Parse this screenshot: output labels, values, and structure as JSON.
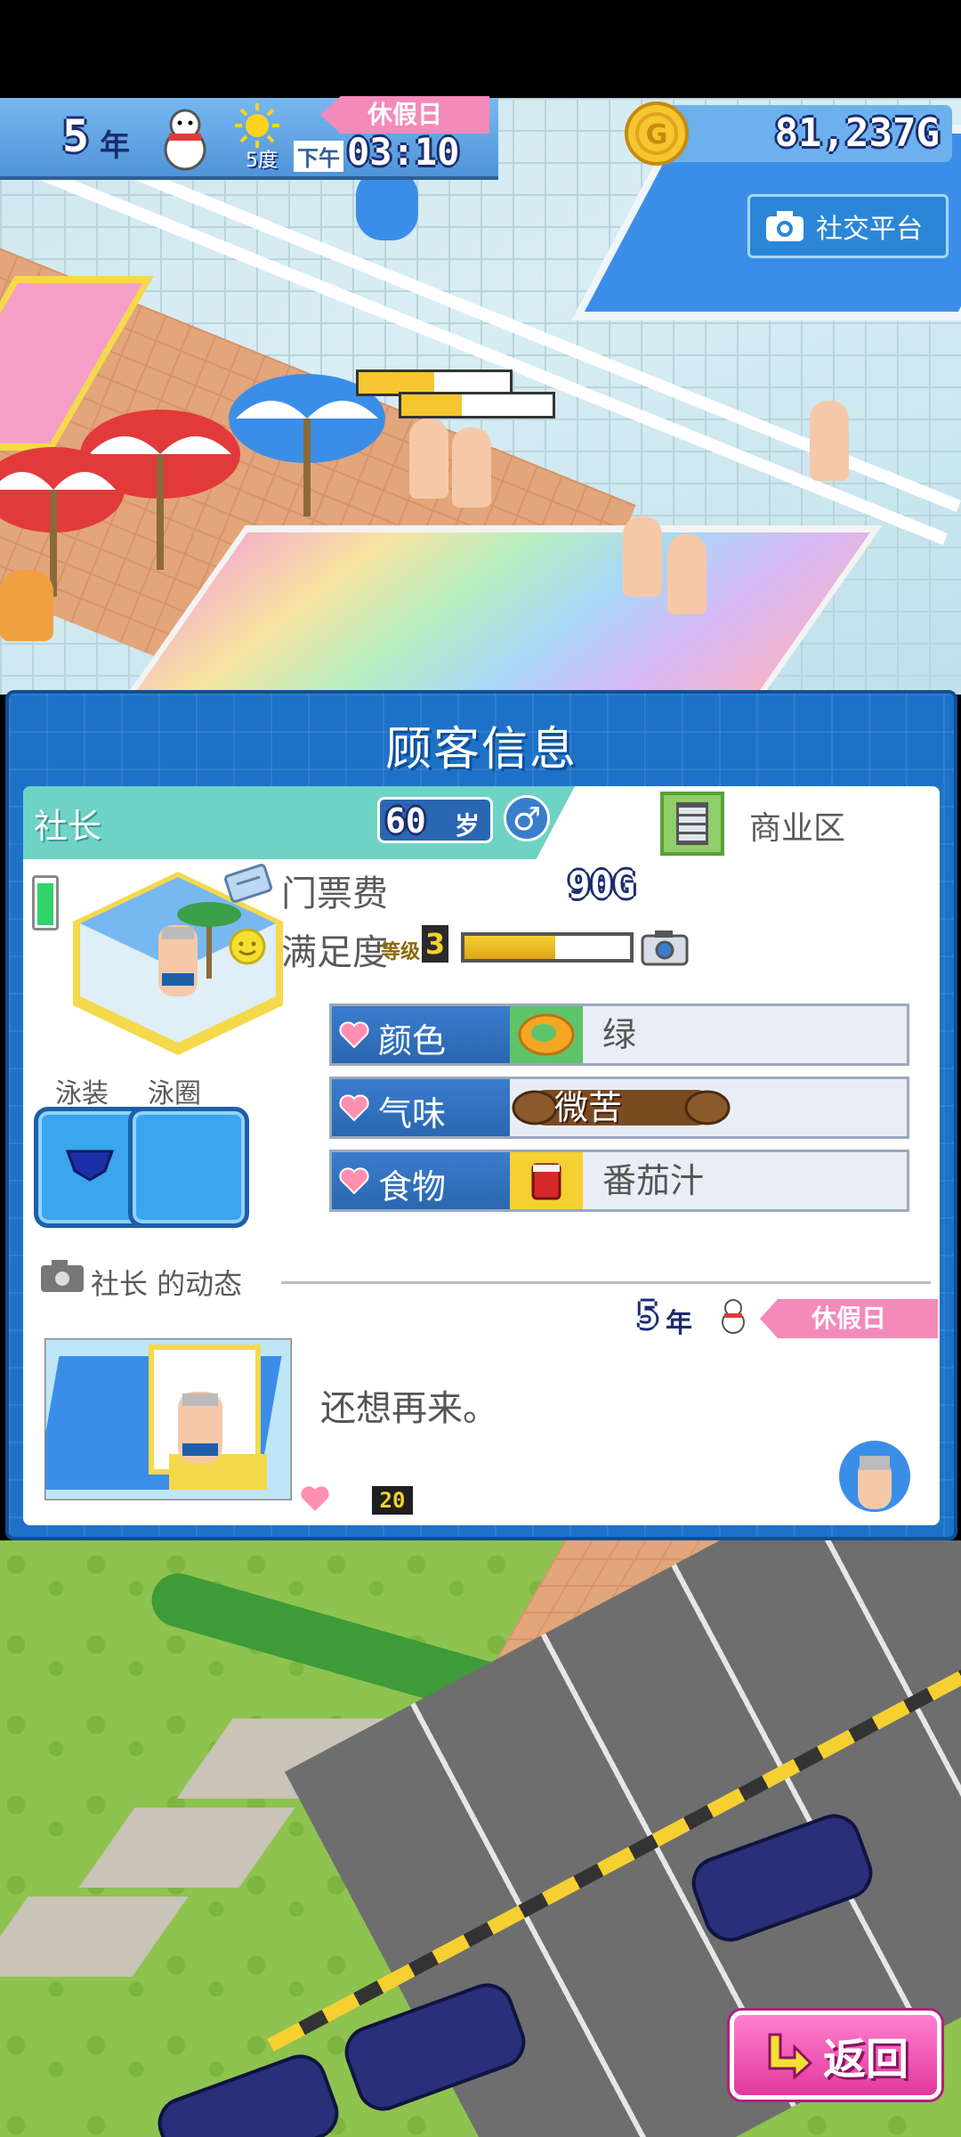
{
  "hud": {
    "year_num": "5",
    "year_unit": "年",
    "weather_temp": "5度",
    "time_period": "下午",
    "time": "03:10",
    "day_type": "休假日",
    "money": "81,237G"
  },
  "sns_button": {
    "label": "社交平台"
  },
  "dialog": {
    "title": "顾客信息",
    "customer": {
      "name": "社长",
      "age_num": "60",
      "age_unit": "岁",
      "gender_symbol": "♂",
      "district": "商业区"
    },
    "ticket_fee": {
      "label": "门票费",
      "value": "90G"
    },
    "satisfaction": {
      "label": "满足度",
      "level_label": "等级",
      "level": "3",
      "fill": 0.55
    },
    "prefs": [
      {
        "label": "颜色",
        "value": "绿"
      },
      {
        "label": "气味",
        "value": "微苦"
      },
      {
        "label": "食物",
        "value": "番茄汁"
      }
    ],
    "equipment": {
      "swimsuit_label": "泳装",
      "float_label": "泳圈"
    },
    "activity": {
      "header": "社长 的动态",
      "year_num": "5",
      "year_unit": "年",
      "day_type": "休假日",
      "message": "还想再来。",
      "likes": "20"
    }
  },
  "back_button": {
    "label": "返回"
  },
  "colors": {
    "panel_blue": "#1d72c8",
    "name_bar_teal": "#6ed3c4",
    "holiday_pink": "#f48ab9",
    "back_pink": "#e2389e"
  }
}
